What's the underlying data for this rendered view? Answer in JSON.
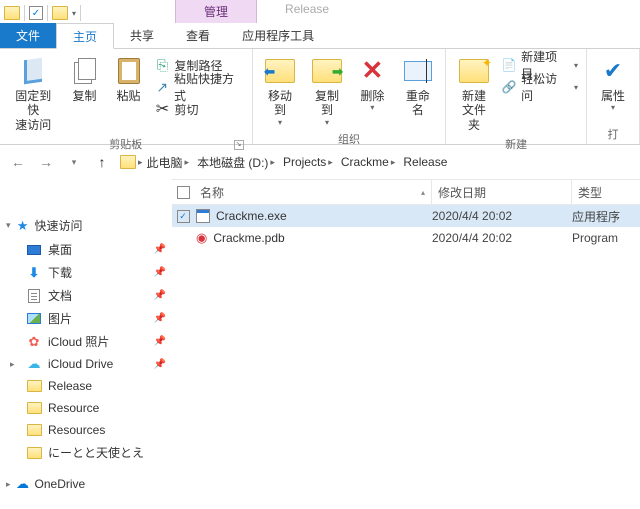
{
  "qat": {
    "context_tab": "管理",
    "window_title": "Release"
  },
  "tabs": {
    "file": "文件",
    "home": "主页",
    "share": "共享",
    "view": "查看",
    "app_tools": "应用程序工具"
  },
  "ribbon": {
    "pin": "固定到快\n速访问",
    "copy": "复制",
    "paste": "粘贴",
    "copy_path": "复制路径",
    "paste_shortcut": "粘贴快捷方式",
    "cut": "剪切",
    "clipboard_group": "剪贴板",
    "move_to": "移动到",
    "copy_to": "复制到",
    "delete": "删除",
    "rename": "重命名",
    "organize_group": "组织",
    "new_folder": "新建\n文件夹",
    "new_item": "新建项目",
    "easy_access": "轻松访问",
    "new_group": "新建",
    "properties": "属性",
    "open_group": "打"
  },
  "breadcrumb": {
    "this_pc": "此电脑",
    "drive": "本地磁盘 (D:)",
    "projects": "Projects",
    "crackme": "Crackme",
    "release": "Release"
  },
  "columns": {
    "name": "名称",
    "date": "修改日期",
    "type": "类型"
  },
  "sidebar": {
    "quick_access": "快速访问",
    "desktop": "桌面",
    "downloads": "下载",
    "documents": "文档",
    "pictures": "图片",
    "icloud_photos": "iCloud 照片",
    "icloud_drive": "iCloud Drive",
    "release": "Release",
    "resource": "Resource",
    "resources": "Resources",
    "jp_folder": "にーとと天使とえ",
    "onedrive": "OneDrive"
  },
  "files": [
    {
      "name": "Crackme.exe",
      "date": "2020/4/4 20:02",
      "type": "应用程序",
      "selected": true
    },
    {
      "name": "Crackme.pdb",
      "date": "2020/4/4 20:02",
      "type": "Program",
      "selected": false
    }
  ]
}
